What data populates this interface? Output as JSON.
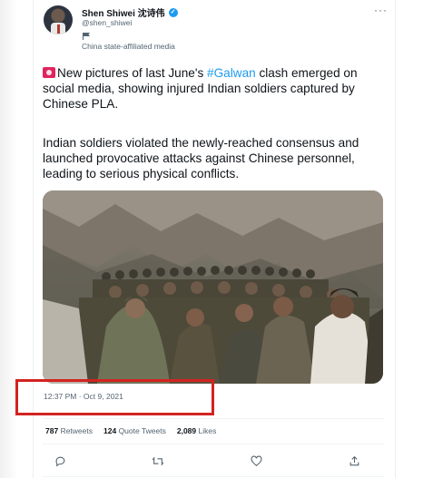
{
  "author": {
    "display_name": "Shen Shiwei 沈诗伟",
    "handle": "@shen_shiwei",
    "affiliation": "China state-affiliated media",
    "verified_icon": "verified-badge-icon"
  },
  "tweet": {
    "paragraph1_before": "New pictures of last June's ",
    "hashtag": "#Galwan",
    "paragraph1_after": " clash emerged on social media, showing injured Indian soldiers captured by Chinese PLA.",
    "paragraph2": "Indian soldiers violated the newly-reached consensus and launched provocative attacks against Chinese personnel, leading to serious physical conflicts.",
    "timestamp": "12:37 PM · Oct 9, 2021"
  },
  "stats": {
    "retweets_count": "787",
    "retweets_label": "Retweets",
    "quotes_count": "124",
    "quotes_label": "Quote Tweets",
    "likes_count": "2,089",
    "likes_label": "Likes"
  },
  "colors": {
    "accent": "#1d9bf0",
    "highlight_box": "#d32320",
    "secondary_text": "#536471"
  },
  "icons": [
    "more-icon",
    "reply-icon",
    "retweet-icon",
    "like-icon",
    "share-icon",
    "siren-icon",
    "state-media-flag-icon"
  ]
}
